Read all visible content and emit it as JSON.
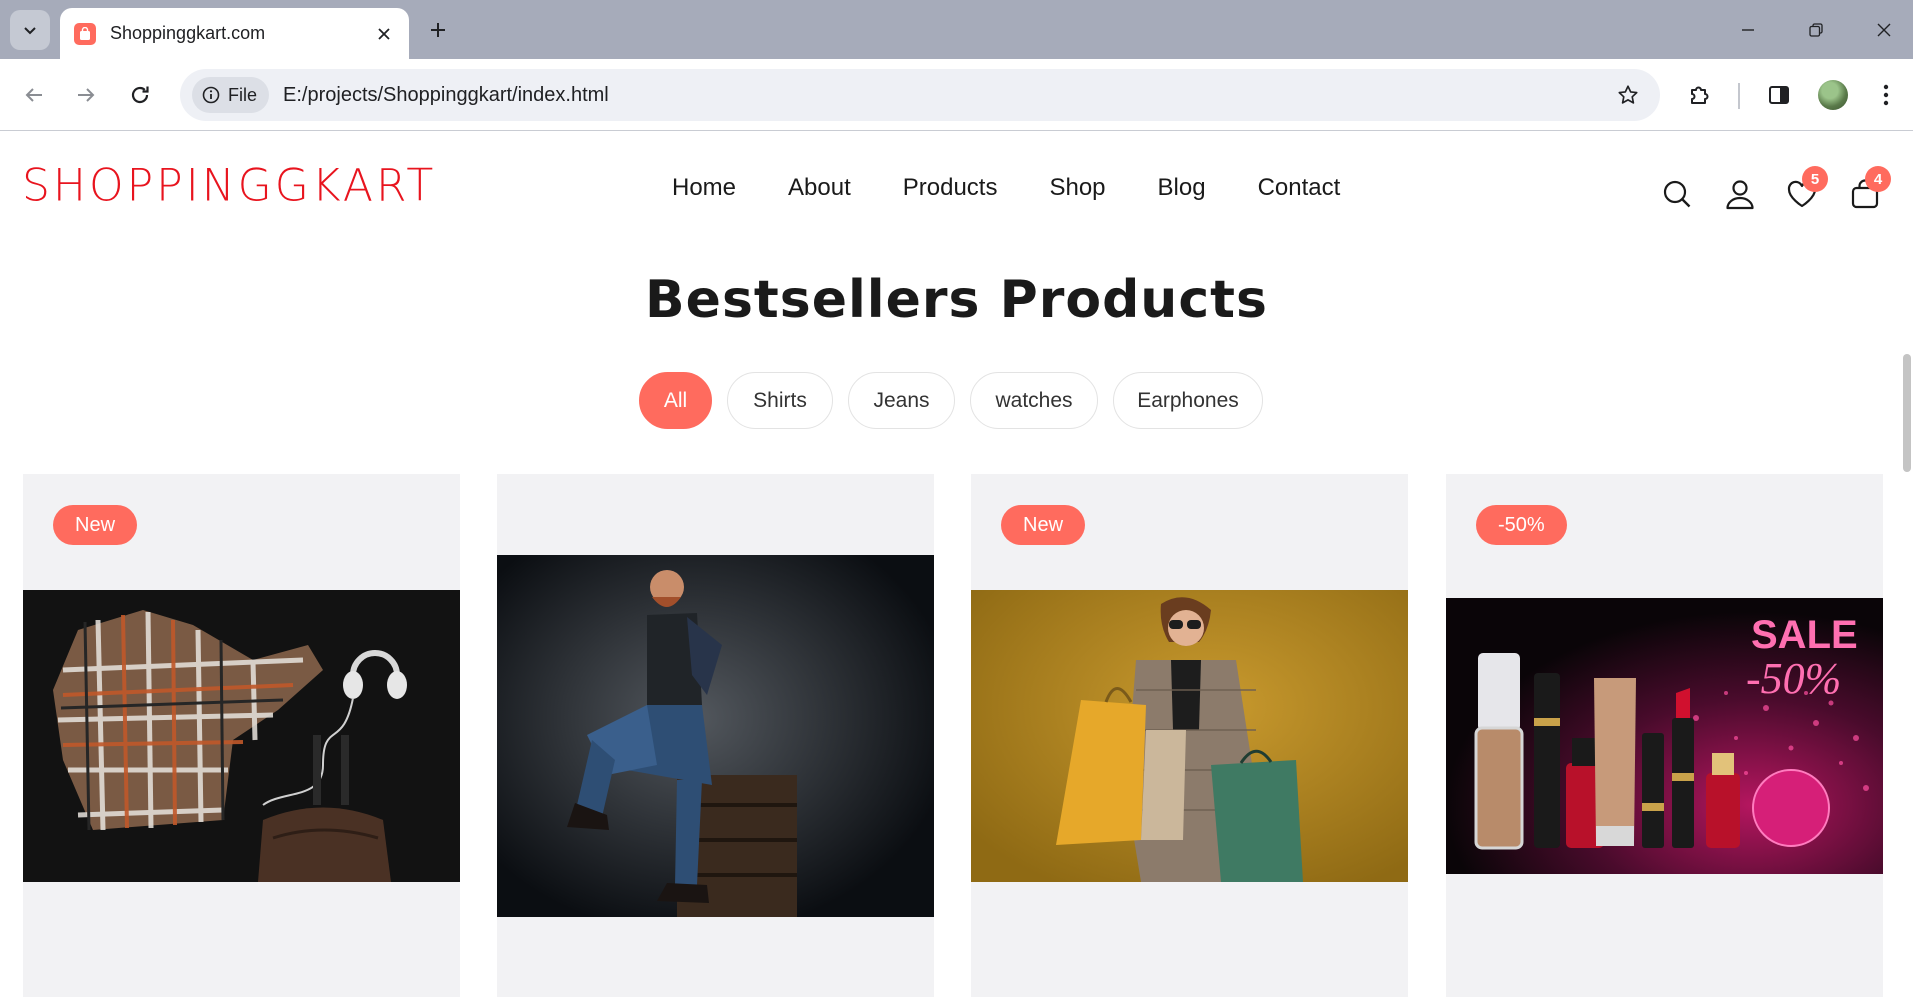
{
  "browser": {
    "tab_title": "Shoppinggkart.com",
    "site_chip": "File",
    "url": "E:/projects/Shoppinggkart/index.html"
  },
  "header": {
    "logo": "SHOPPINGGKART",
    "nav": [
      "Home",
      "About",
      "Products",
      "Shop",
      "Blog",
      "Contact"
    ],
    "wishlist_count": "5",
    "cart_count": "4"
  },
  "section": {
    "title": "Bestsellers Products",
    "filters": [
      "All",
      "Shirts",
      "Jeans",
      "watches",
      "Earphones"
    ],
    "active_filter": "All"
  },
  "products": [
    {
      "tag": "New",
      "image": "plaid-shirt-headphones-bag-photo"
    },
    {
      "tag": "",
      "image": "man-in-jeans-sitting-on-crates-photo"
    },
    {
      "tag": "New",
      "image": "woman-with-shopping-bags-photo"
    },
    {
      "tag": "-50%",
      "image": "cosmetics-sale-banner-photo",
      "banner_sale": "SALE",
      "banner_discount": "-50%"
    }
  ],
  "colors": {
    "accent": "#ff6b5e",
    "logo": "#e8141e",
    "card_bg": "#f2f2f4"
  }
}
